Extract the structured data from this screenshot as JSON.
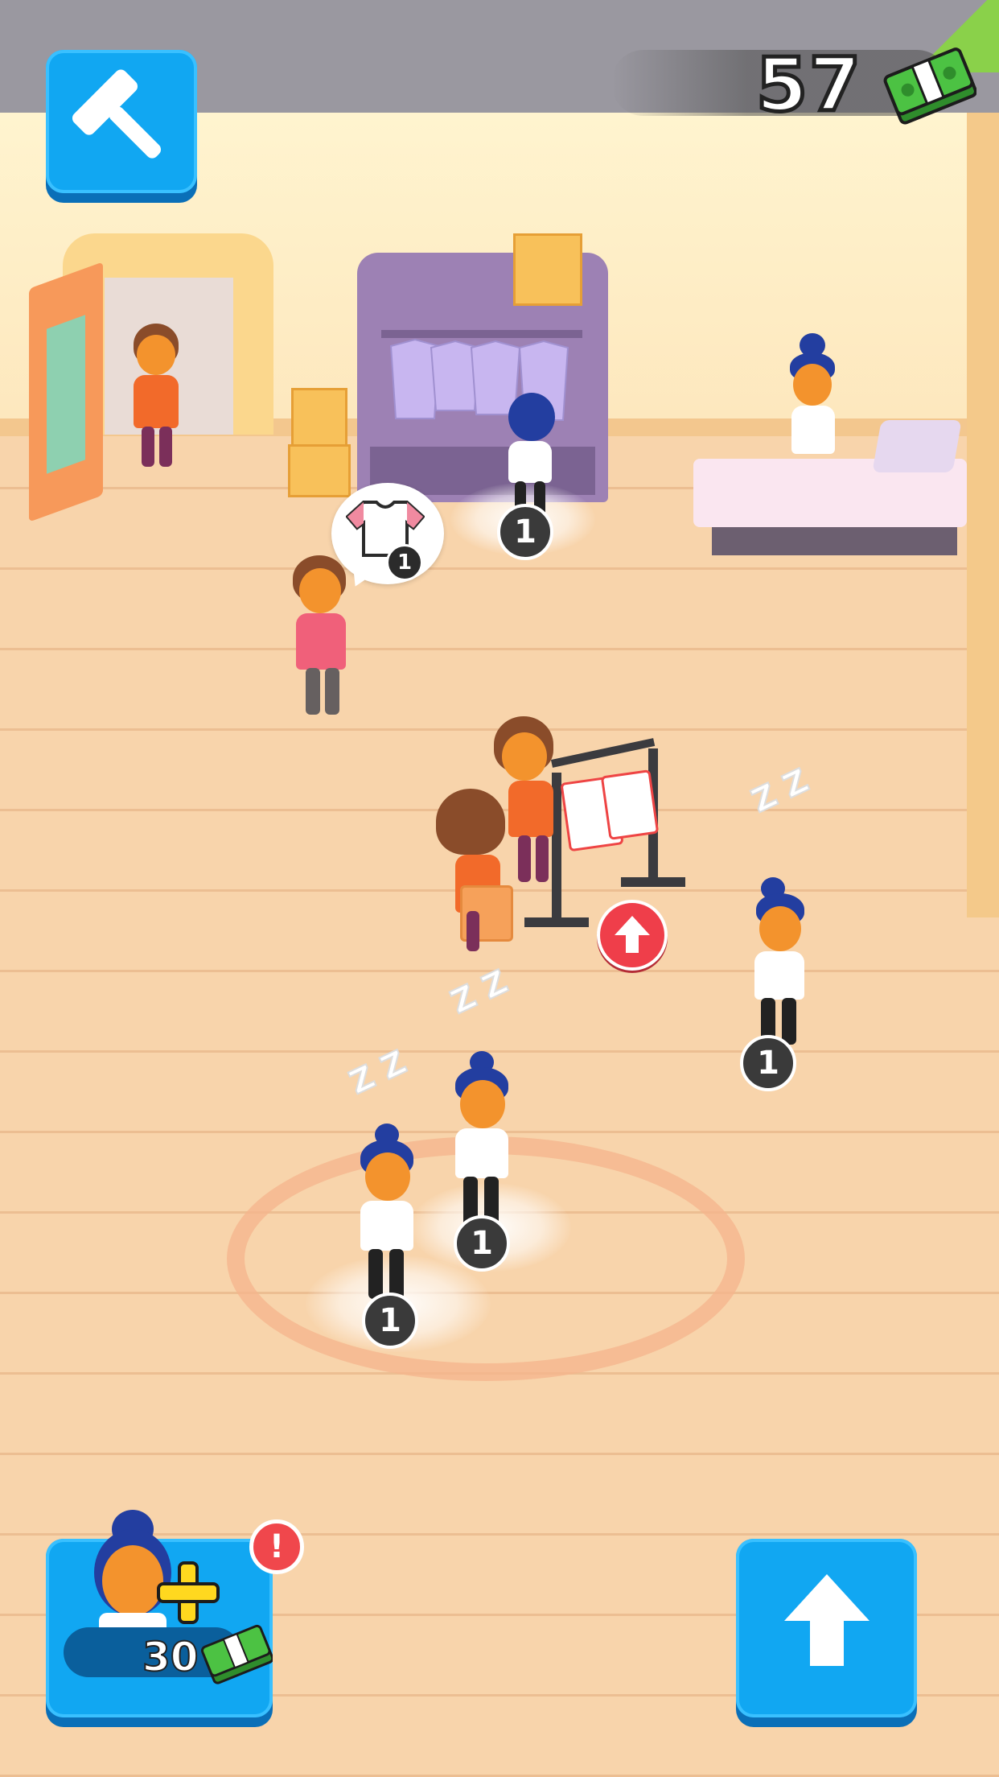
{
  "hud": {
    "money": "57",
    "build_icon": "hammer-icon",
    "money_icon": "cash-stack-icon",
    "hire_price": "30",
    "hire_icon": "hire-employee-icon",
    "hire_alert": "!",
    "upgrade_icon": "arrow-up-icon"
  },
  "speech": {
    "icon": "shirt-icon",
    "count": "1"
  },
  "zone_counts": [
    "1",
    "1",
    "1",
    "1",
    "1"
  ],
  "sleep_marks": [
    "Z Z",
    "Z Z",
    "Z Z"
  ],
  "colors": {
    "button_blue": "#11a7f2",
    "button_shadow": "#0a6fb8",
    "alert_red": "#f0474c",
    "cash_green": "#3fae3a",
    "floor": "#f8d4ab"
  }
}
